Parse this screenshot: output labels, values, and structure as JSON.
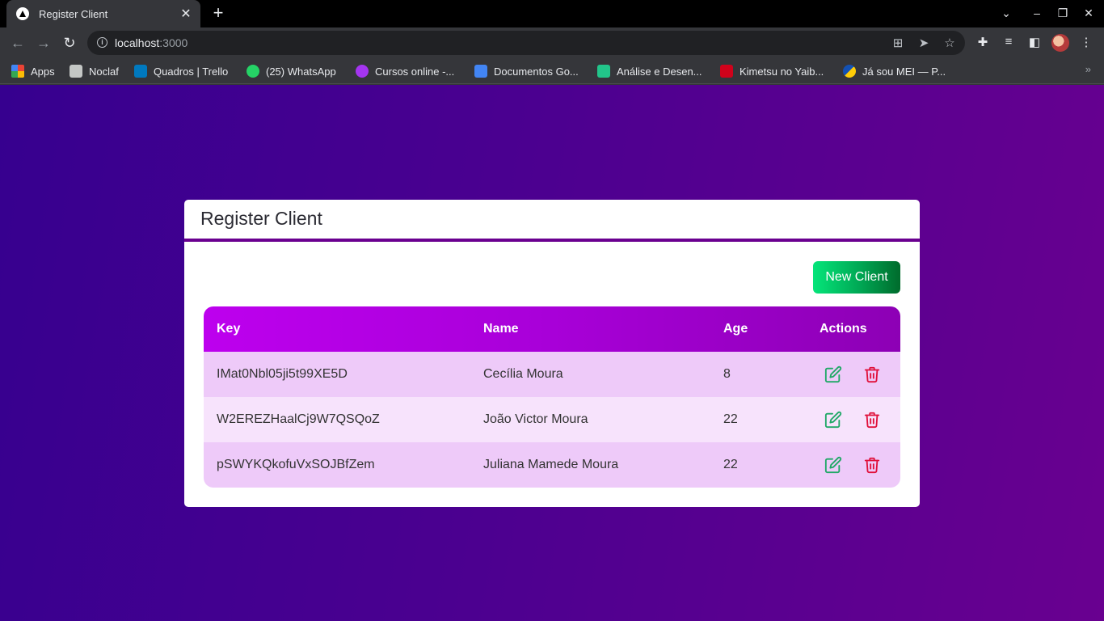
{
  "browser": {
    "tab_title": "Register Client",
    "tab_close": "✕",
    "new_tab": "+",
    "address": {
      "host": "localhost",
      "port": ":3000"
    },
    "bookmarks": [
      {
        "label": "Apps",
        "icon": "apps-grid-icon",
        "color": "#ea4335"
      },
      {
        "label": "Noclaf",
        "icon": "folder-icon",
        "color": "#c4c7c5"
      },
      {
        "label": "Quadros | Trello",
        "icon": "trello-icon",
        "color": "#0079bf"
      },
      {
        "label": "(25) WhatsApp",
        "icon": "whatsapp-icon",
        "color": "#25d366"
      },
      {
        "label": "Cursos online -...",
        "icon": "udemy-icon",
        "color": "#a435f0"
      },
      {
        "label": "Documentos Go...",
        "icon": "google-docs-icon",
        "color": "#4285f4"
      },
      {
        "label": "Análise e Desen...",
        "icon": "site-icon",
        "color": "#22c58a"
      },
      {
        "label": "Kimetsu no Yaib...",
        "icon": "tv-icon",
        "color": "#d0021b"
      },
      {
        "label": "Já sou MEI — P...",
        "icon": "gov-icon",
        "color": "#1351b4"
      }
    ],
    "bookmarks_more": "»"
  },
  "card": {
    "title": "Register Client",
    "new_client_label": "New Client"
  },
  "table": {
    "headers": {
      "key": "Key",
      "name": "Name",
      "age": "Age",
      "actions": "Actions"
    },
    "rows": [
      {
        "key": "IMat0Nbl05ji5t99XE5D",
        "name": "Cecília Moura",
        "age": "8"
      },
      {
        "key": "W2EREZHaalCj9W7QSQoZ",
        "name": "João Victor Moura",
        "age": "22"
      },
      {
        "key": "pSWYKQkofuVxSOJBfZem",
        "name": "Juliana Mamede Moura",
        "age": "22"
      }
    ]
  },
  "colors": {
    "edit": "#1fa866",
    "delete": "#e0103a",
    "header_gradient_start": "#bd00ee",
    "accent": "#6a0090"
  }
}
